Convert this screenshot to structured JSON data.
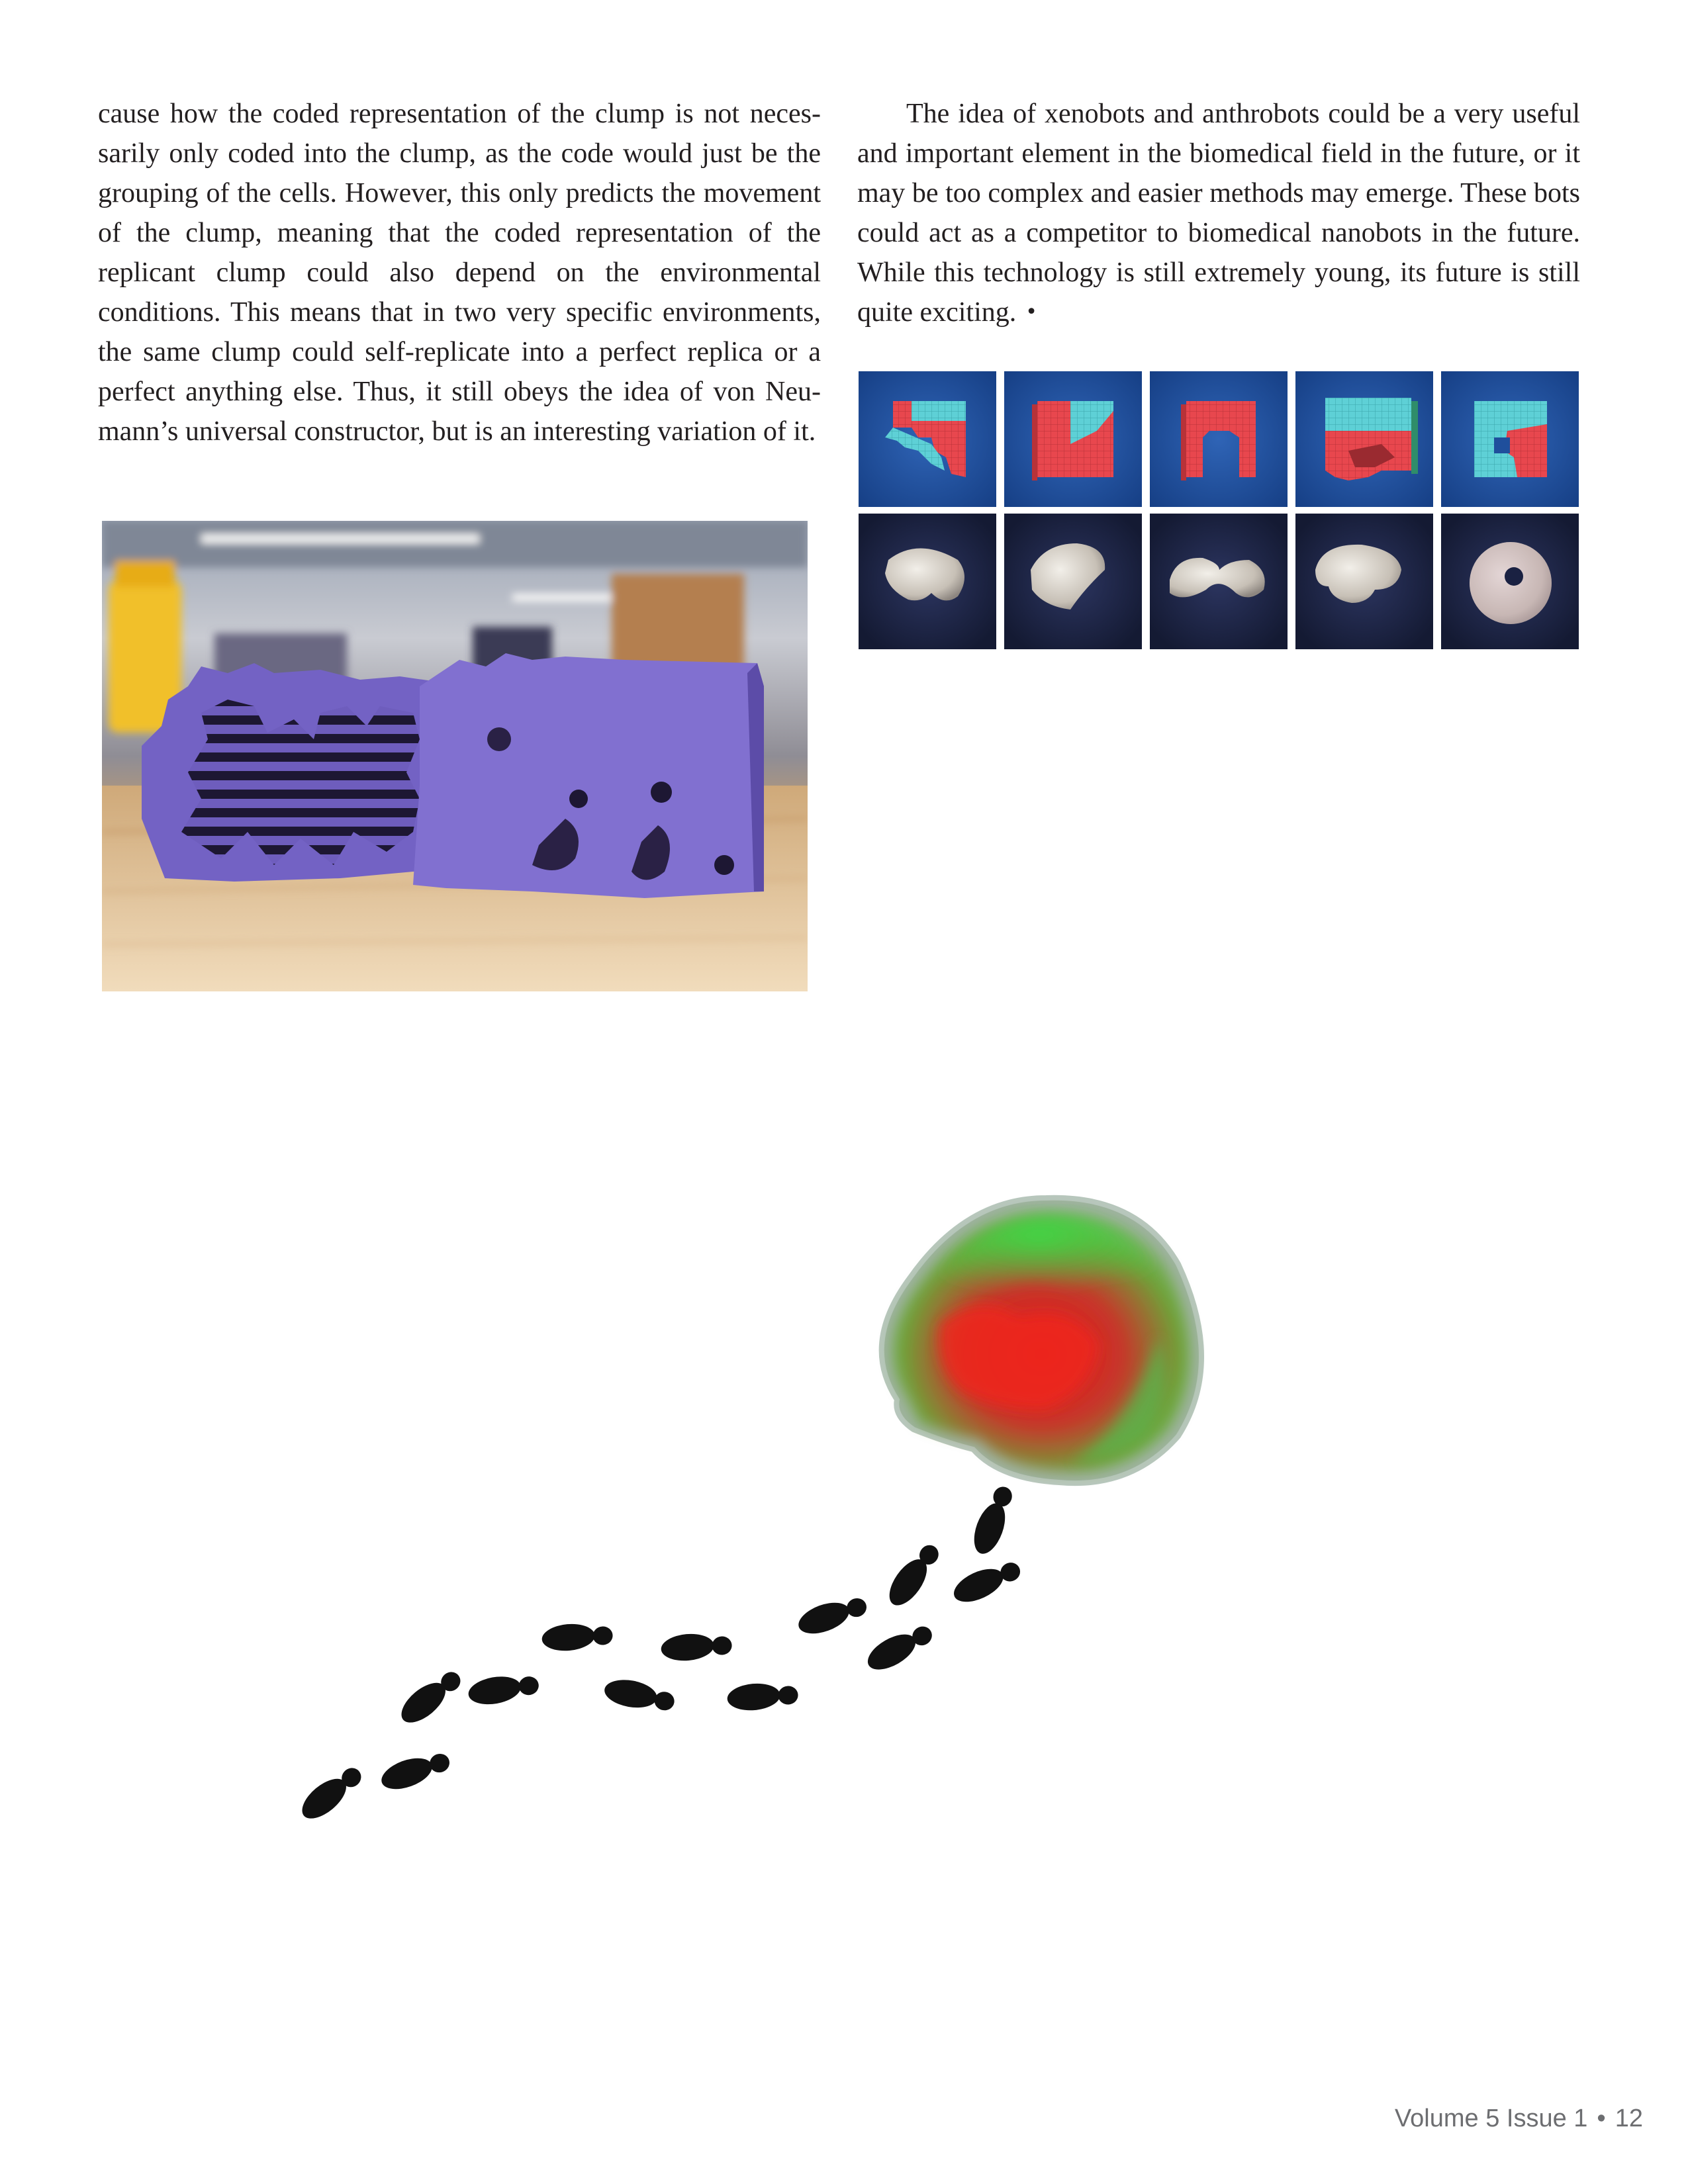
{
  "article": {
    "left_column": "cause how the coded representation of the clump is not neces­sarily only coded into the clump, as the code would just be the grouping of the cells. However, this only predicts the move­ment of the clump, meaning that the coded representation of the replicant clump could also depend on the environmental conditions. This means that in two very specific environments, the same clump could self-replicate into a perfect replica or a perfect anything else. Thus, it still obeys the idea of von Neu­mann’s universal constructor, but is an interesting variation of it.",
    "right_column": "The idea of xenobots and anthrobots could be a very useful and important element in the biomedical field in the future, or it may be too complex and easier methods may emerge. These bots could act as a competitor to biomedical nanobots in the future. While this technology is still extremely young, its future is still quite exciting.",
    "end_mark": "•"
  },
  "images": {
    "mold_photo": "photo-3d-printed-purple-molds",
    "bot_designs": "grid-simulated-designs-and-real-xenobots",
    "xenobot_trail": "xenobot-with-footprint-trail"
  },
  "colors": {
    "text": "#231f20",
    "footer": "#6d6e71",
    "design_bg": "#1f4f9c",
    "cell_red": "#e8474e",
    "cell_cyan": "#5ed0d6",
    "purple_mold": "#7a68c8"
  },
  "footer": {
    "volume": "Volume 5 Issue 1",
    "separator": "•",
    "page_number": "12"
  }
}
